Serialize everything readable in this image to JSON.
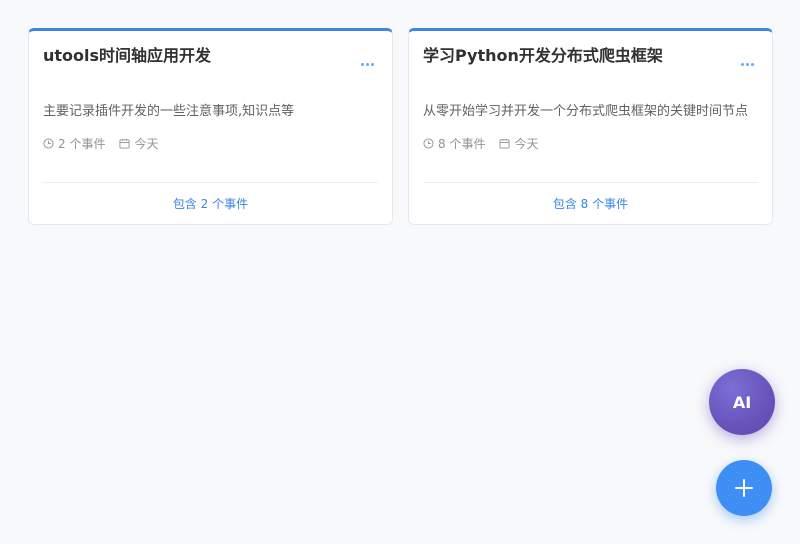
{
  "timelines": [
    {
      "title": "utools时间轴应用开发",
      "description": "主要记录插件开发的一些注意事项,知识点等",
      "event_count": "2 个事件",
      "date": "今天",
      "footer_link": "包含 2 个事件"
    },
    {
      "title": "学习Python开发分布式爬虫框架",
      "description": "从零开始学习并开发一个分布式爬虫框架的关键时间节点",
      "event_count": "8 个事件",
      "date": "今天",
      "footer_link": "包含 8 个事件"
    }
  ],
  "fab": {
    "ai_label": "AI",
    "add_icon": "plus-icon"
  },
  "colors": {
    "accent": "#3a87e6",
    "ai_button": "#6a55bd",
    "add_button": "#3f8ef5",
    "background": "#f8f9fb"
  }
}
